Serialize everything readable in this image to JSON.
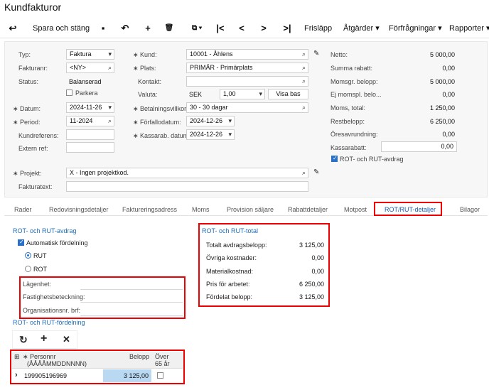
{
  "title": "Kundfakturor",
  "toolbar": {
    "back_icon": "↩",
    "save_close": "Spara och stäng",
    "save_icon": "▪",
    "undo_icon": "↶",
    "add_icon": "+",
    "delete_icon": "🗑",
    "copy_icon": "⧉ ▾",
    "first_icon": "|<",
    "prev_icon": "<",
    "next_icon": ">",
    "last_icon": ">|",
    "release": "Frisläpp",
    "actions": "Åtgärder ▾",
    "inquiries": "Förfrågningar ▾",
    "reports": "Rapporter ▾"
  },
  "form": {
    "type_label": "Typ:",
    "type_value": "Faktura",
    "invoice_label": "Fakturanr:",
    "invoice_value": "<NY>",
    "status_label": "Status:",
    "status_value": "Balanserad",
    "hold_label": "Parkera",
    "date_label": "Datum:",
    "date_value": "2024-11-26",
    "period_label": "Period:",
    "period_value": "11-2024",
    "custref_label": "Kundreferens:",
    "extref_label": "Extern ref:",
    "customer_label": "Kund:",
    "customer_value": "10001 - Åhlens",
    "location_label": "Plats:",
    "location_value": "PRIMÄR - Primärplats",
    "contact_label": "Kontakt:",
    "currency_label": "Valuta:",
    "currency_value": "SEK",
    "rate_value": "1,00",
    "view_base": "Visa bas",
    "terms_label": "Betalningsvillkor:",
    "terms_value": "30 - 30 dagar",
    "due_label": "Förfallodatum:",
    "due_value": "2024-12-26",
    "discdate_label": "Kassarab. datum:",
    "discdate_value": "2024-12-26",
    "project_label": "Projekt:",
    "project_value": "X - Ingen projektkod.",
    "invoicetext_label": "Fakturatext:"
  },
  "summary": {
    "net_label": "Netto:",
    "net_value": "5 000,00",
    "discount_label": "Summa rabatt:",
    "discount_value": "0,00",
    "taxable_label": "Momsgr. belopp:",
    "taxable_value": "5 000,00",
    "exempt_label": "Ej momspl. belo...",
    "exempt_value": "0,00",
    "vat_label": "Moms, total:",
    "vat_value": "1 250,00",
    "balance_label": "Restbelopp:",
    "balance_value": "6 250,00",
    "rounding_label": "Öresavrundning:",
    "rounding_value": "0,00",
    "cashdisc_label": "Kassarabatt:",
    "cashdisc_value": "0,00",
    "rot_label": "ROT- och RUT-avdrag"
  },
  "tabs": [
    "Rader",
    "Redovisningsdetaljer",
    "Faktureringsadress",
    "Moms",
    "Provision säljare",
    "Rabattdetaljer",
    "Motpost",
    "ROT/RUT-detaljer",
    "Bilagor"
  ],
  "rot": {
    "section_title": "ROT- och RUT-avdrag",
    "auto_label": "Automatisk fördelning",
    "rut_label": "RUT",
    "rot_label": "ROT",
    "apartment_label": "Lägenhet:",
    "property_label": "Fastighetsbeteckning:",
    "orgnr_label": "Organisationsnr. brf:",
    "dist_title": "ROT- och RUT-fördelning"
  },
  "totals": {
    "section_title": "ROT- och RUT-total",
    "total_label": "Totalt avdragsbelopp:",
    "total_value": "3 125,00",
    "other_label": "Övriga kostnader:",
    "other_value": "0,00",
    "material_label": "Materialkostnad:",
    "material_value": "0,00",
    "work_label": "Pris för arbetet:",
    "work_value": "6 250,00",
    "dist_label": "Fördelat belopp:",
    "dist_value": "3 125,00"
  },
  "grid": {
    "refresh_icon": "↻",
    "add_icon": "+",
    "remove_icon": "✕",
    "settings_icon": "⊞",
    "col_person": "∗ Personnr",
    "col_person2": "(ÅÅÅÅMMDDNNNN)",
    "col_amount": "Belopp",
    "col_over": "Över",
    "col_over2": "65 år",
    "row_arrow": "›",
    "row_person": "199905196969",
    "row_amount": "3 125,00"
  }
}
